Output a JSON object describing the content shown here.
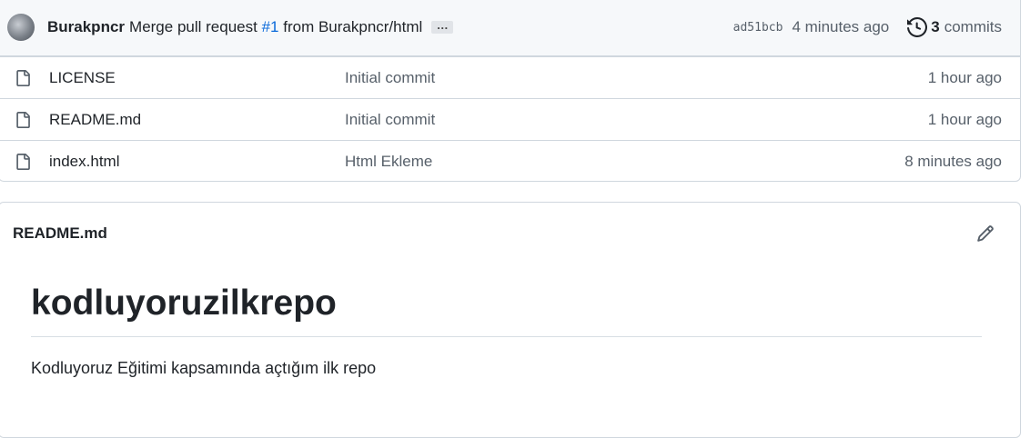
{
  "commit": {
    "author": "Burakpncr",
    "message_prefix": "Merge pull request",
    "pr_ref": "#1",
    "message_suffix": "from Burakpncr/html",
    "ellipsis": "…",
    "sha": "ad51bcb",
    "time": "4 minutes ago",
    "commit_count": "3",
    "commits_label": "commits"
  },
  "files": [
    {
      "name": "LICENSE",
      "message": "Initial commit",
      "time": "1 hour ago",
      "icon": "file-icon"
    },
    {
      "name": "README.md",
      "message": "Initial commit",
      "time": "1 hour ago",
      "icon": "file-icon"
    },
    {
      "name": "index.html",
      "message": "Html Ekleme",
      "time": "8 minutes ago",
      "icon": "file-icon"
    }
  ],
  "readme": {
    "filename": "README.md",
    "heading": "kodluyoruzilkrepo",
    "paragraph": "Kodluyoruz Eğitimi kapsamında açtığım ilk repo",
    "edit_icon": "pencil-icon"
  },
  "colors": {
    "link": "#0969da",
    "muted": "#57606a",
    "border": "#d0d7de",
    "header_bg": "#f6f8fa"
  }
}
